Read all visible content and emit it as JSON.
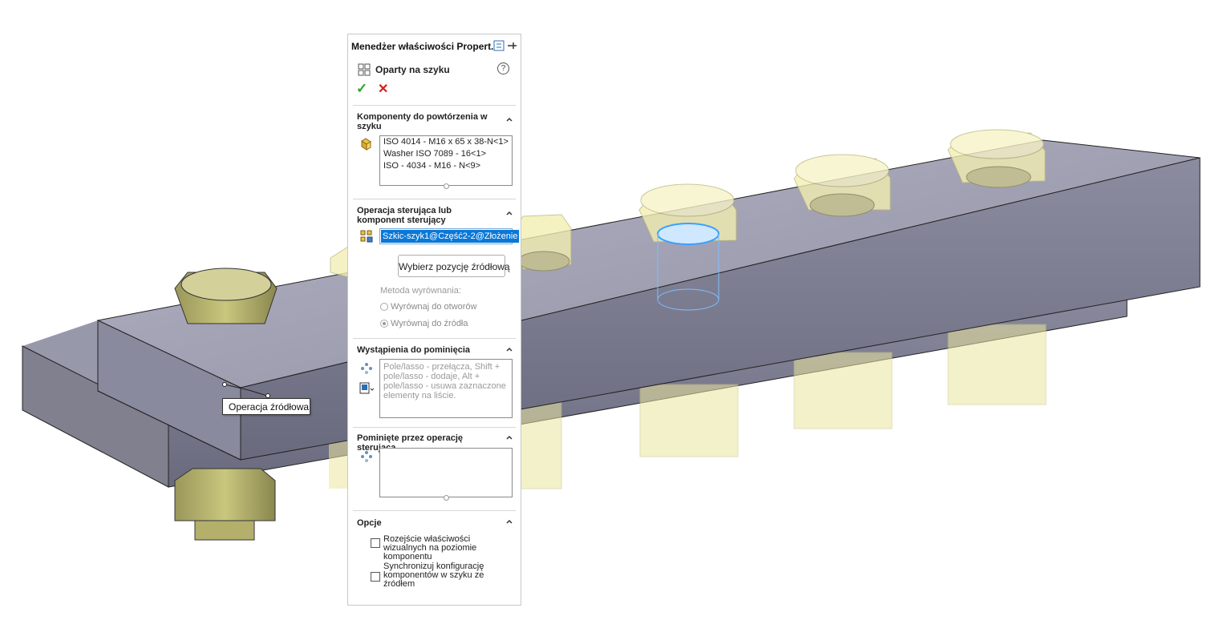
{
  "tooltip": "Operacja źródłowa",
  "panel": {
    "title": "Menedżer właściwości Propert...",
    "feature_name": "Oparty na szyku",
    "help_label": "?",
    "ok_label": "✓",
    "cancel_label": "✕",
    "components_section": {
      "title": "Komponenty do powtórzenia w szyku",
      "items": [
        "ISO 4014 - M16 x 65 x 38-N<1>",
        "Washer ISO 7089 - 16<1>",
        "ISO - 4034 - M16 - N<9>"
      ]
    },
    "driving_section": {
      "title": "Operacja sterująca lub komponent sterujący",
      "selection": "Szkic-szyk1@Część2-2@Złożenie",
      "select_source_button": "Wybierz pozycję źródłową",
      "alignment_label": "Metoda wyrównania:",
      "align_holes": "Wyrównaj do otworów",
      "align_source": "Wyrównaj do źródła",
      "selected_alignment": "Wyrównaj do źródła"
    },
    "skip_section": {
      "title": "Wystąpienia do pominięcia",
      "placeholder": "Pole/lasso - przełącza, Shift + pole/lasso - dodaje, Alt + pole/lasso - usuwa zaznaczone elementy na liście."
    },
    "skipped_section": {
      "title": "Pominięte przez operację sterującą"
    },
    "options_section": {
      "title": "Opcje",
      "option1": "Rozejście właściwości wizualnych na poziomie komponentu",
      "option2": "Synchronizuj konfigurację komponentów w szyku ze źródłem",
      "option1_checked": false,
      "option2_checked": false
    }
  },
  "colors": {
    "plate_top": "#a9a9bd",
    "plate_side": "#7a7a8e",
    "bolt_solid": "#b8b56e",
    "bolt_transparent": "#f4f0b0",
    "selection_blue": "#0a78d7",
    "ok_green": "#2aa52a",
    "cancel_red": "#d02020"
  }
}
